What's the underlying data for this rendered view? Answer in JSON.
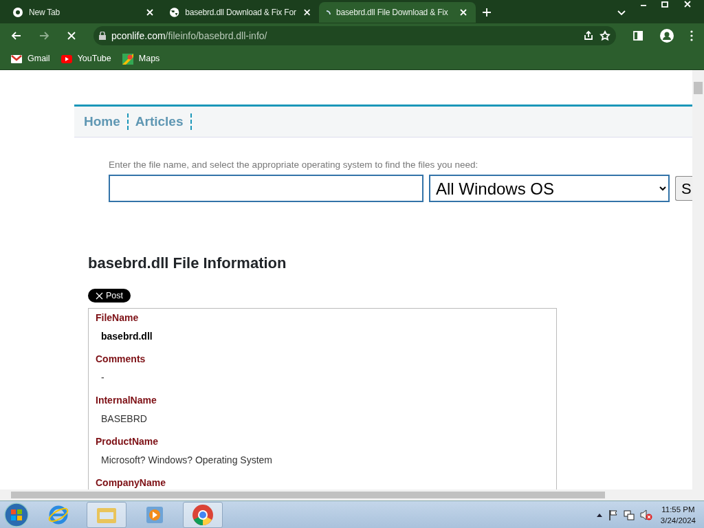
{
  "tabs": [
    {
      "title": "New Tab",
      "kind": "newtab",
      "selected": false
    },
    {
      "title": "basebrd.dll Download & Fix For",
      "kind": "page",
      "selected": false
    },
    {
      "title": "basebrd.dll File Download & Fix",
      "kind": "loading",
      "selected": true
    }
  ],
  "address": {
    "host": "pconlife.com",
    "path": "/fileinfo/basebrd.dll-info/"
  },
  "bookmarks": [
    "Gmail",
    "YouTube",
    "Maps"
  ],
  "site_nav": [
    "Home",
    "Articles"
  ],
  "search": {
    "hint": "Enter the file name, and select the appropriate operating system to find the files you need:",
    "os": "All Windows OS",
    "button": "S"
  },
  "heading": "basebrd.dll File Information",
  "post_button": "Post",
  "fields": [
    {
      "label": "FileName",
      "value": "basebrd.dll",
      "bold": true
    },
    {
      "label": "Comments",
      "value": "-",
      "bold": false
    },
    {
      "label": "InternalName",
      "value": "BASEBRD",
      "bold": false
    },
    {
      "label": "ProductName",
      "value": "Microsoft? Windows? Operating System",
      "bold": false
    },
    {
      "label": "CompanyName"
    }
  ],
  "taskbar": {
    "items": [
      {
        "open": false
      },
      {
        "open": true
      },
      {
        "open": false
      },
      {
        "open": true
      }
    ],
    "time": "11:55 PM",
    "date": "3/24/2024"
  }
}
